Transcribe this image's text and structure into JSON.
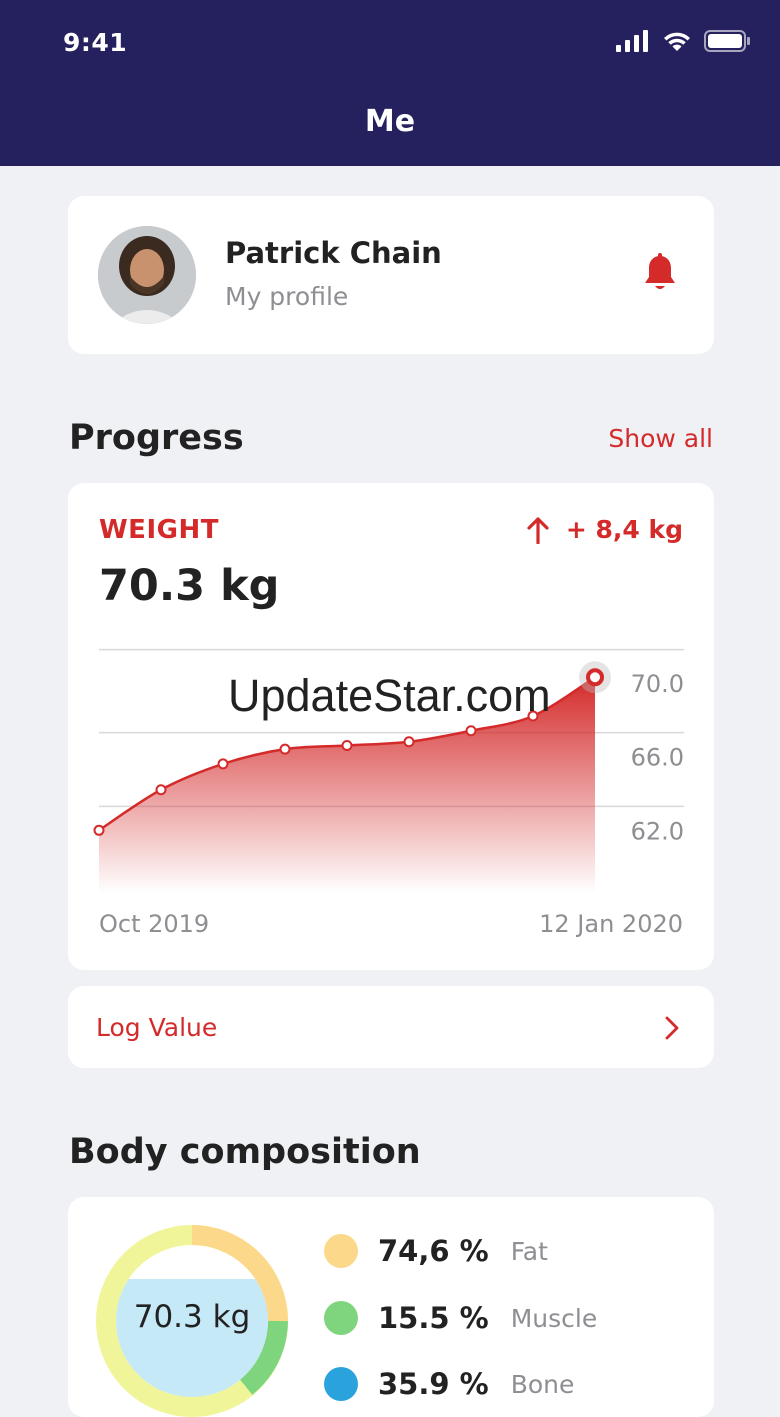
{
  "status_bar": {
    "time": "9:41"
  },
  "nav": {
    "title": "Me"
  },
  "profile": {
    "name": "Patrick Chain",
    "subtitle": "My profile"
  },
  "progress": {
    "title": "Progress",
    "show_all": "Show all",
    "weight_label": "WEIGHT",
    "delta": "+ 8,4 kg",
    "value": "70.3 kg"
  },
  "chart_data": {
    "type": "area",
    "title": "",
    "xlabel": "",
    "ylabel": "",
    "x_start_label": "Oct 2019",
    "x_end_label": "12 Jan 2020",
    "y_ticks": [
      "70.0",
      "66.0",
      "62.0"
    ],
    "y_tick_values": [
      70.0,
      66.0,
      62.0
    ],
    "ylim": [
      58.6,
      72.7
    ],
    "series": [
      {
        "values": [
          62.0,
          64.2,
          65.6,
          66.4,
          66.6,
          66.8,
          67.4,
          68.2,
          70.3
        ]
      }
    ],
    "grid": true
  },
  "log": {
    "label": "Log Value"
  },
  "body_composition": {
    "title": "Body composition",
    "center_value": "70.3 kg",
    "items": [
      {
        "pct": "74,6 %",
        "name": "Fat",
        "color": "#fcd88a"
      },
      {
        "pct": "15.5 %",
        "name": "Muscle",
        "color": "#7ed57e"
      },
      {
        "pct": "35.9 %",
        "name": "Bone",
        "color": "#2aa3dc"
      }
    ]
  },
  "colors": {
    "accent": "#d42a2a",
    "navbar": "#24215e",
    "background": "#eff1f5"
  },
  "watermark": "UpdateStar.com"
}
